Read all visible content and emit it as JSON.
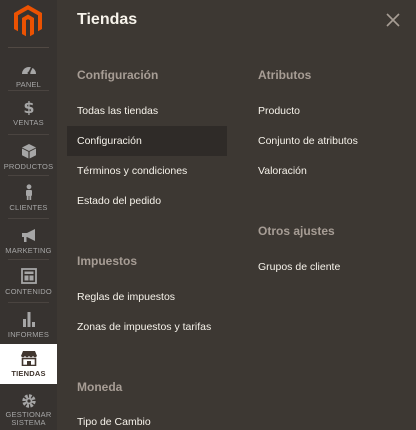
{
  "rail": {
    "items": [
      {
        "label": "PANEL",
        "icon": "dashboard-icon"
      },
      {
        "label": "VENTAS",
        "icon": "dollar-icon"
      },
      {
        "label": "PRODUCTOS",
        "icon": "box-icon"
      },
      {
        "label": "CLIENTES",
        "icon": "person-icon"
      },
      {
        "label": "MARKETING",
        "icon": "megaphone-icon"
      },
      {
        "label": "CONTENIDO",
        "icon": "layout-icon"
      },
      {
        "label": "INFORMES",
        "icon": "bar-chart-icon"
      },
      {
        "label": "TIENDAS",
        "icon": "storefront-icon",
        "active": true
      },
      {
        "label_lines": [
          "GESTIONAR",
          "SISTEMA"
        ],
        "icon": "gear-icon"
      }
    ]
  },
  "panel": {
    "title": "Tiendas",
    "columns": [
      {
        "sections": [
          {
            "title": "Configuración",
            "links": [
              "Todas las tiendas",
              "Configuración",
              "Términos y condiciones",
              "Estado del pedido"
            ],
            "active_index": 1
          },
          {
            "title": "Impuestos",
            "links": [
              "Reglas de impuestos",
              "Zonas de impuestos y tarifas"
            ]
          },
          {
            "title": "Moneda",
            "links": [
              "Tipo de Cambio"
            ]
          }
        ]
      },
      {
        "sections": [
          {
            "title": "Atributos",
            "links": [
              "Producto",
              "Conjunto de atributos",
              "Valoración"
            ]
          },
          {
            "title": "Otros ajustes",
            "links": [
              "Grupos de cliente"
            ]
          }
        ]
      }
    ]
  },
  "colors": {
    "brand": "#eb5202",
    "rail_bg": "#373330",
    "panel_bg": "#3d3833",
    "active_link_bg": "#2f2b28"
  }
}
